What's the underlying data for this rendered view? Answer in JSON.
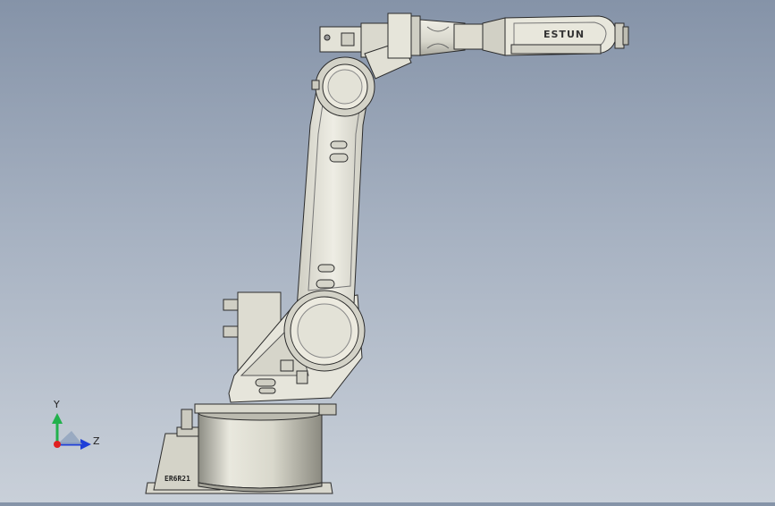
{
  "viewport": {
    "model": {
      "brand_label": "ESTUN",
      "base_plate_label": "ER6R21"
    },
    "triad": {
      "y_label": "Y",
      "z_label": "Z",
      "colors": {
        "y": "#22b14c",
        "z": "#1f3fd8",
        "origin": "#e02020"
      }
    },
    "colors": {
      "background_top": "#8593a8",
      "background_bottom": "#c9d0d9",
      "body_fill": "#e7e6dc",
      "outline": "#2b2b2b"
    }
  }
}
